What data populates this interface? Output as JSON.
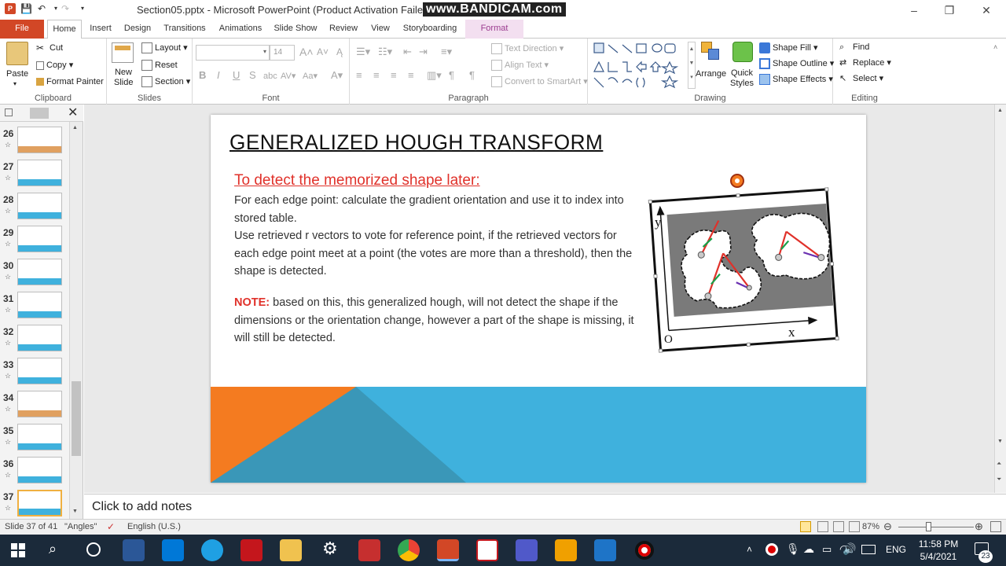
{
  "titlebar": {
    "doc_title": "Section05.pptx - Microsoft PowerPoint (Product Activation Failed)",
    "watermark": "www.BANDICAM.com",
    "minimize": "–",
    "restore": "❐",
    "close": "✕"
  },
  "tabs": [
    "File",
    "Home",
    "Insert",
    "Design",
    "Transitions",
    "Animations",
    "Slide Show",
    "Review",
    "View",
    "Storyboarding",
    "Format"
  ],
  "ribbon": {
    "clipboard": {
      "paste": "Paste",
      "cut": "Cut",
      "copy": "Copy",
      "format_painter": "Format Painter",
      "label": "Clipboard"
    },
    "slides": {
      "new_slide": "New Slide",
      "layout": "Layout",
      "reset": "Reset",
      "section": "Section",
      "label": "Slides"
    },
    "font": {
      "font_size": "14",
      "bold": "B",
      "italic": "I",
      "underline": "U",
      "strike": "S",
      "spacing": "abc",
      "case": "Aa",
      "label": "Font"
    },
    "paragraph": {
      "text_direction": "Text Direction",
      "align_text": "Align Text",
      "convert": "Convert to SmartArt",
      "label": "Paragraph"
    },
    "drawing": {
      "arrange": "Arrange",
      "quick_styles": "Quick Styles",
      "shape_fill": "Shape Fill",
      "shape_outline": "Shape Outline",
      "shape_effects": "Shape Effects",
      "label": "Drawing"
    },
    "editing": {
      "find": "Find",
      "replace": "Replace",
      "select": "Select",
      "label": "Editing"
    }
  },
  "thumbnails": [
    {
      "num": "26",
      "star": "☆"
    },
    {
      "num": "27",
      "star": "☆"
    },
    {
      "num": "28",
      "star": "☆"
    },
    {
      "num": "29",
      "star": "☆"
    },
    {
      "num": "30",
      "star": "☆"
    },
    {
      "num": "31",
      "star": "☆"
    },
    {
      "num": "32",
      "star": "☆"
    },
    {
      "num": "33",
      "star": "☆"
    },
    {
      "num": "34",
      "star": "☆"
    },
    {
      "num": "35",
      "star": "☆"
    },
    {
      "num": "36",
      "star": "☆"
    },
    {
      "num": "37",
      "star": "☆"
    }
  ],
  "slide": {
    "title": "GENERALIZED HOUGH TRANSFORM",
    "subtitle": "To detect the memorized shape later:",
    "para1": "For each edge point: calculate the gradient orientation and use it to index into stored table.",
    "para2": "Use retrieved r vectors to vote for reference point, if the retrieved vectors for each edge point meet at a point (the votes are more than a threshold), then the shape is detected.",
    "note_label": "NOTE:",
    "note_text": " based on this, this generalized hough, will not detect the shape if the dimensions or the orientation change, however a part of the shape is missing, it will still be detected.",
    "figure": {
      "y_label": "y",
      "x_label": "x",
      "origin_label": "O"
    }
  },
  "notes_placeholder": "Click to add notes",
  "status": {
    "slide_pos": "Slide 37 of 41",
    "theme": "\"Angles\"",
    "language": "English (U.S.)",
    "zoom": "87%"
  },
  "clock": {
    "time": "11:58 PM",
    "date": "5/4/2021",
    "lang": "ENG",
    "notif": "23"
  },
  "colors": {
    "accent": "#d24726",
    "slide_red": "#e0312a",
    "banner_blue": "#3fb1dd",
    "banner_orange": "#f47b20"
  }
}
